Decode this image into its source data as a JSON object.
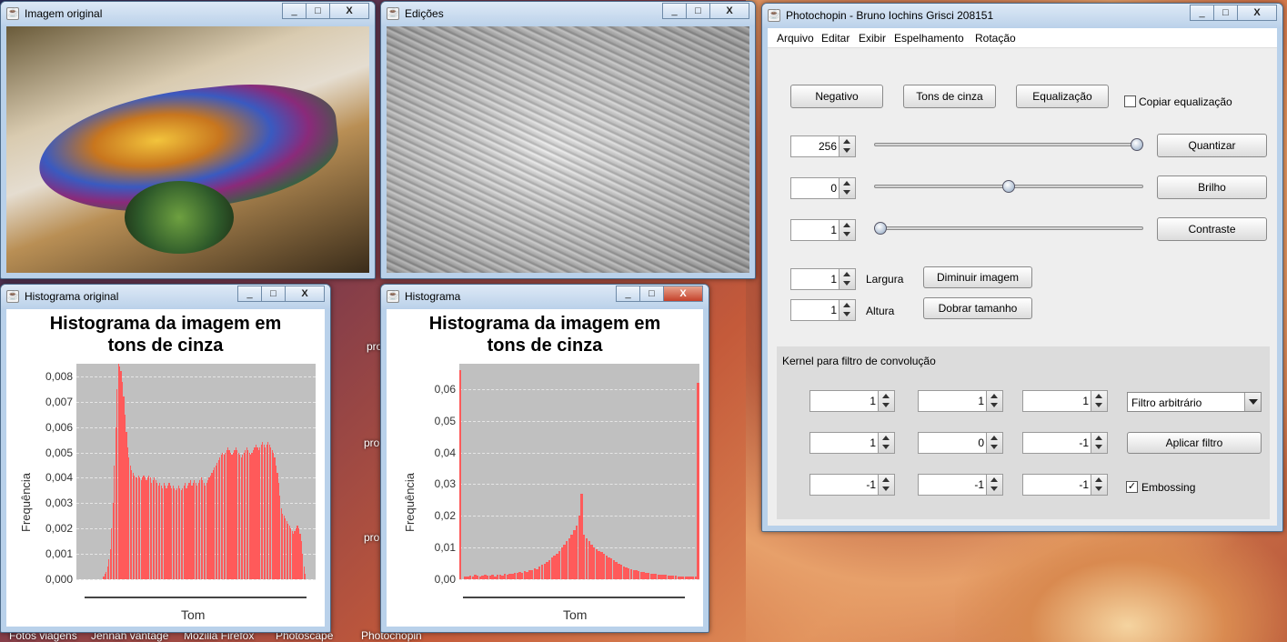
{
  "desktop": {
    "labels": [
      "pro",
      "pro",
      "pro"
    ],
    "taskbar_labels": [
      "Fotos viagens",
      "Jennah vantage",
      "Mozilla Firefox",
      "Photoscape",
      "Photochopin"
    ]
  },
  "windows": {
    "original": {
      "title": "Imagem original",
      "buttons": [
        "_",
        "□",
        "X"
      ]
    },
    "edits": {
      "title": "Edições",
      "buttons": [
        "_",
        "□",
        "X"
      ]
    },
    "hist_original": {
      "title": "Histograma original",
      "buttons": [
        "_",
        "□",
        "X"
      ],
      "chart_title": "Histograma da imagem em tons de cinza",
      "ylabel": "Frequência",
      "xlabel": "Tom",
      "yticks": [
        "0,008",
        "0,007",
        "0,006",
        "0,005",
        "0,004",
        "0,003",
        "0,002",
        "0,001",
        "0,000"
      ]
    },
    "hist_edit": {
      "title": "Histograma",
      "buttons": [
        "_",
        "□",
        "X"
      ],
      "chart_title": "Histograma da imagem em tons de cinza",
      "ylabel": "Frequência",
      "xlabel": "Tom",
      "yticks": [
        "0,06",
        "0,05",
        "0,04",
        "0,03",
        "0,02",
        "0,01",
        "0,00"
      ]
    },
    "main": {
      "title": "Photochopin - Bruno Iochins Grisci 208151",
      "buttons": [
        "_",
        "□",
        "X"
      ],
      "menu": [
        "Arquivo",
        "Editar",
        "Exibir",
        "Espelhamento",
        "Rotação"
      ],
      "btn_negativo": "Negativo",
      "btn_tons": "Tons de cinza",
      "btn_equalizacao": "Equalização",
      "chk_copiar_label": "Copiar equalização",
      "chk_copiar_checked": false,
      "quant_value": "256",
      "quant_level": 1.0,
      "btn_quantizar": "Quantizar",
      "brilho_value": "0",
      "brilho_level": 0.5,
      "btn_brilho": "Brilho",
      "contraste_value": "1",
      "contraste_level": 0.0,
      "btn_contraste": "Contraste",
      "largura_value": "1",
      "largura_label": "Largura",
      "btn_diminuir": "Diminuir imagem",
      "altura_value": "1",
      "altura_label": "Altura",
      "btn_dobrar": "Dobrar tamanho",
      "kernel_title": "Kernel para filtro de convolução",
      "kernel": [
        "1",
        "1",
        "1",
        "1",
        "0",
        "-1",
        "-1",
        "-1",
        "-1"
      ],
      "combo_filtro": "Filtro arbitrário",
      "btn_aplicar": "Aplicar filtro",
      "chk_embossing_label": "Embossing",
      "chk_embossing_checked": true
    }
  },
  "chart_data": [
    {
      "type": "bar",
      "title": "Histograma da imagem em tons de cinza",
      "xlabel": "Tom",
      "ylabel": "Frequência",
      "ylim": [
        0,
        0.0085
      ],
      "x_range": [
        0,
        255
      ],
      "series": [
        {
          "values": [
            0,
            0,
            0,
            0,
            0,
            0,
            0,
            0,
            0,
            0,
            0,
            0,
            0,
            0,
            0,
            0,
            0,
            0,
            0,
            0,
            0.0001,
            0.0002,
            0.0003,
            0.0005,
            0.0008,
            0.0012,
            0.002,
            0.003,
            0.0045,
            0.006,
            0.0075,
            0.0085,
            0.0084,
            0.0082,
            0.0078,
            0.0072,
            0.0065,
            0.0058,
            0.0052,
            0.0048,
            0.0045,
            0.0043,
            0.0042,
            0.0041,
            0.004,
            0.004,
            0.0041,
            0.004,
            0.0039,
            0.004,
            0.0041,
            0.004,
            0.0039,
            0.004,
            0.0041,
            0.004,
            0.0038,
            0.0039,
            0.004,
            0.0039,
            0.0038,
            0.0037,
            0.0038,
            0.0037,
            0.0036,
            0.0038,
            0.0037,
            0.0036,
            0.0037,
            0.0038,
            0.0037,
            0.0036,
            0.0037,
            0.0036,
            0.0035,
            0.0036,
            0.0037,
            0.0036,
            0.0035,
            0.0036,
            0.0037,
            0.0038,
            0.0036,
            0.0037,
            0.0038,
            0.0039,
            0.0037,
            0.0038,
            0.0039,
            0.0038,
            0.0037,
            0.0038,
            0.0039,
            0.004,
            0.0039,
            0.0038,
            0.0037,
            0.0038,
            0.0039,
            0.004,
            0.0041,
            0.0042,
            0.0043,
            0.0044,
            0.0045,
            0.0046,
            0.0047,
            0.0048,
            0.0049,
            0.005,
            0.0049,
            0.005,
            0.0051,
            0.0052,
            0.0051,
            0.005,
            0.0049,
            0.005,
            0.0051,
            0.0052,
            0.0051,
            0.005,
            0.0049,
            0.0048,
            0.0049,
            0.005,
            0.0051,
            0.0052,
            0.0051,
            0.005,
            0.0049,
            0.005,
            0.0051,
            0.0052,
            0.0053,
            0.0052,
            0.0051,
            0.0052,
            0.0053,
            0.0054,
            0.0053,
            0.0052,
            0.0053,
            0.0054,
            0.0053,
            0.0052,
            0.0051,
            0.005,
            0.0048,
            0.0045,
            0.0042,
            0.0038,
            0.0033,
            0.0028,
            0.0026,
            0.0025,
            0.0024,
            0.0023,
            0.0022,
            0.0021,
            0.002,
            0.0019,
            0.0018,
            0.0019,
            0.002,
            0.0021,
            0.002,
            0.0018,
            0.0015,
            0.001,
            0.0005,
            0.0002,
            0,
            0,
            0,
            0,
            0,
            0,
            0
          ]
        }
      ]
    },
    {
      "type": "bar",
      "title": "Histograma da imagem em tons de cinza",
      "xlabel": "Tom",
      "ylabel": "Frequência",
      "ylim": [
        0,
        0.068
      ],
      "x_range": [
        0,
        255
      ],
      "series": [
        {
          "values": [
            0.066,
            0,
            0.001,
            0.001,
            0.0012,
            0.001,
            0.0013,
            0.0011,
            0.001,
            0.0012,
            0.0014,
            0.0011,
            0.0012,
            0.0013,
            0.001,
            0.0015,
            0.0014,
            0.0012,
            0.0016,
            0.0015,
            0.0018,
            0.0016,
            0.002,
            0.0019,
            0.0022,
            0.0021,
            0.0025,
            0.0024,
            0.003,
            0.0028,
            0.0035,
            0.0032,
            0.004,
            0.0045,
            0.005,
            0.0055,
            0.006,
            0.007,
            0.0075,
            0.008,
            0.009,
            0.01,
            0.011,
            0.012,
            0.013,
            0.014,
            0.0155,
            0.017,
            0.02,
            0.027,
            0.014,
            0.013,
            0.012,
            0.011,
            0.01,
            0.0095,
            0.009,
            0.0085,
            0.008,
            0.0075,
            0.007,
            0.0065,
            0.006,
            0.0055,
            0.005,
            0.0045,
            0.004,
            0.0038,
            0.0035,
            0.0032,
            0.003,
            0.0028,
            0.0026,
            0.0024,
            0.0022,
            0.002,
            0.0019,
            0.0018,
            0.0017,
            0.0016,
            0.0015,
            0.0014,
            0.0014,
            0.0013,
            0.0012,
            0.0012,
            0.0011,
            0.0011,
            0.001,
            0.001,
            0.001,
            0.0009,
            0.0009,
            0.0009,
            0.0008,
            0.0008,
            0.062
          ]
        }
      ]
    }
  ]
}
